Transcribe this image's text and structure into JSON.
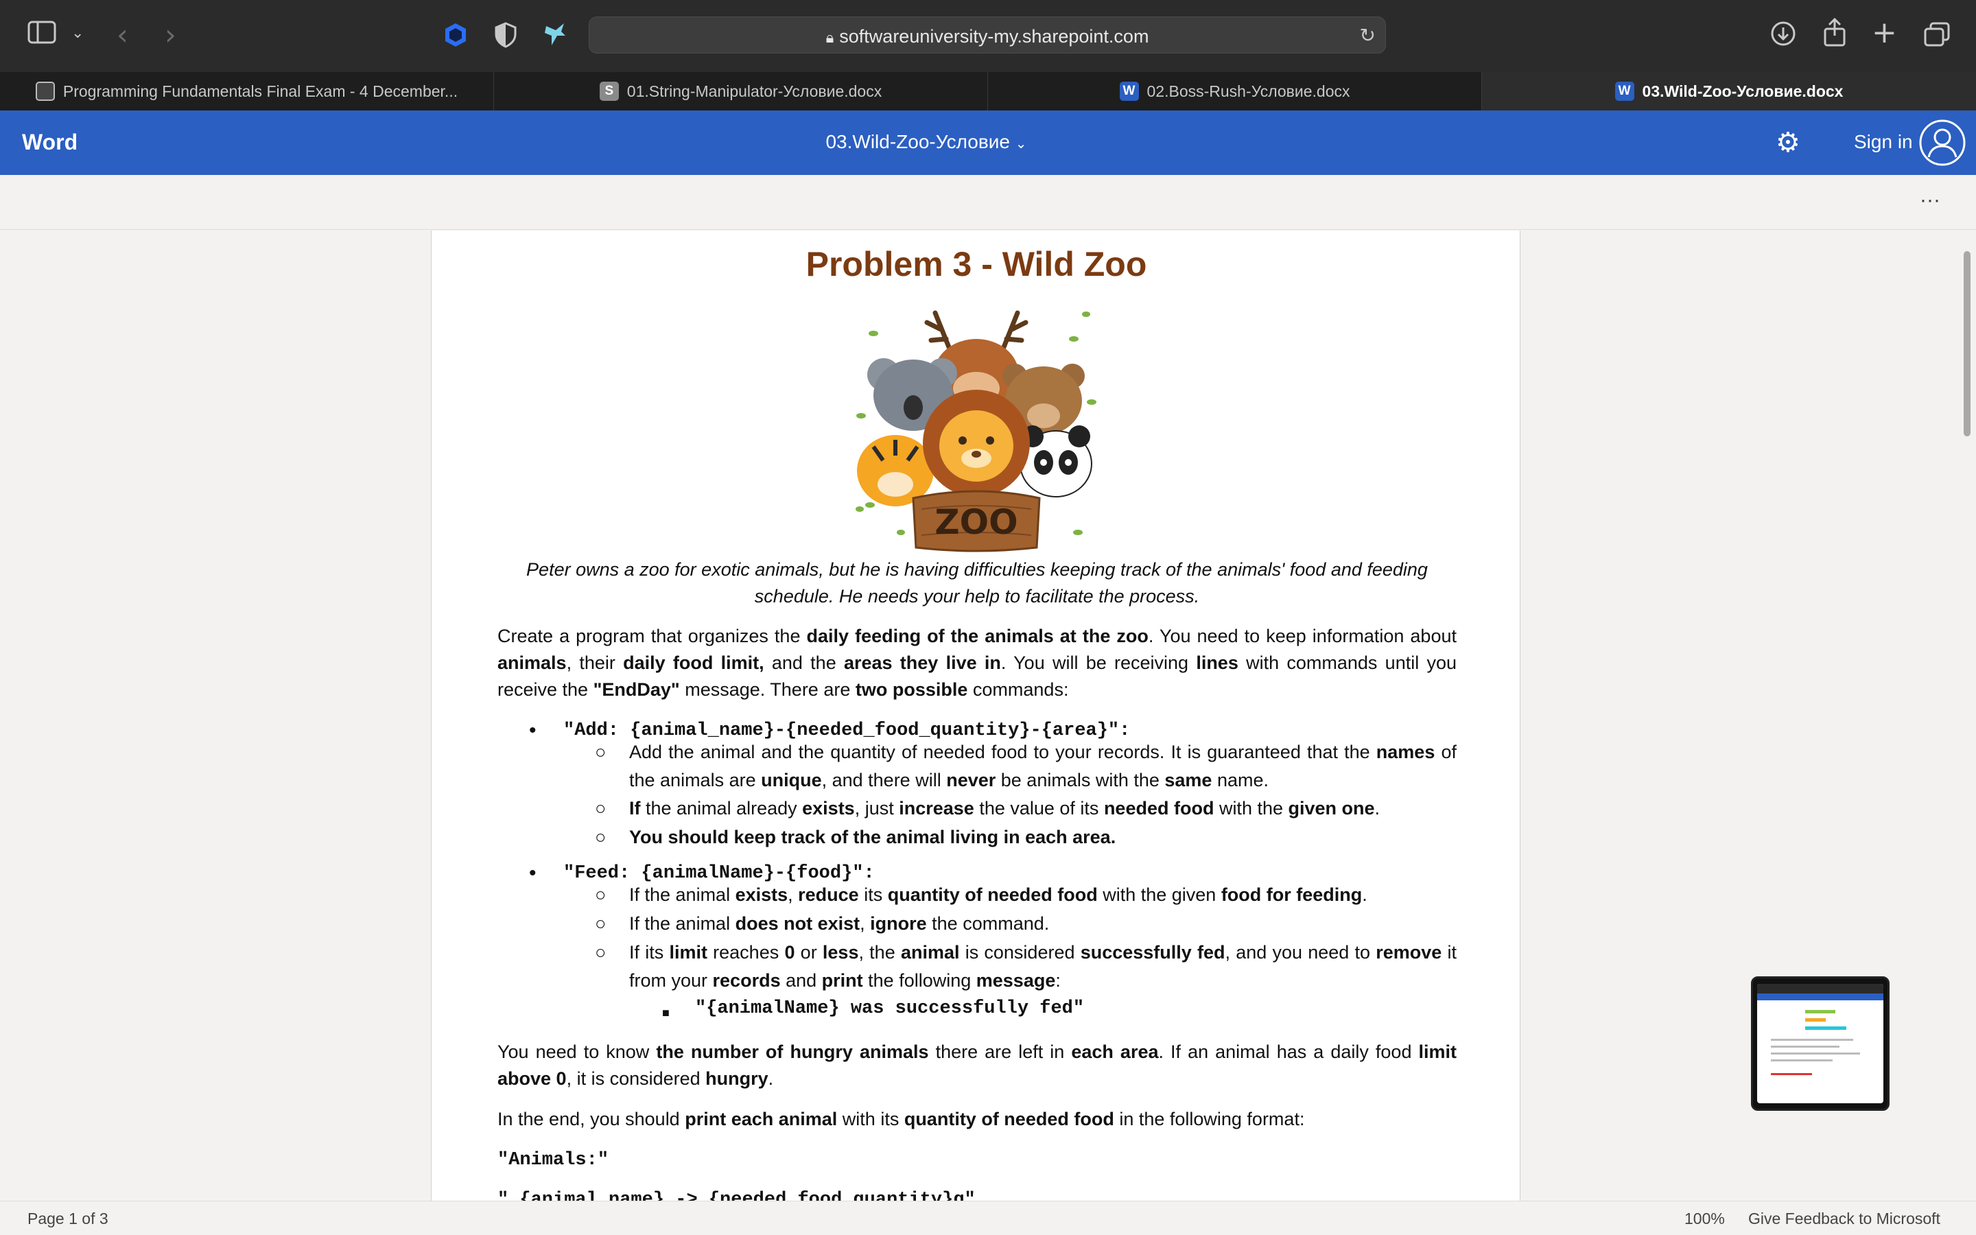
{
  "browser": {
    "url": "softwareuniversity-my.sharepoint.com",
    "tabs": [
      {
        "label": "Programming Fundamentals Final Exam - 4 December...",
        "favicon": "monitor-icon",
        "active": false
      },
      {
        "label": "01.String-Manipulator-Условие.docx",
        "favicon": "S",
        "active": false
      },
      {
        "label": "02.Boss-Rush-Условие.docx",
        "favicon": "W",
        "active": false
      },
      {
        "label": "03.Wild-Zoo-Условие.docx",
        "favicon": "W",
        "active": true
      }
    ]
  },
  "app": {
    "name": "Word",
    "doc_title": "03.Wild-Zoo-Условие",
    "sign_in": "Sign in",
    "more": "···",
    "brand_color": "#2b5fc1"
  },
  "doc": {
    "title": "Problem 3 - Wild Zoo",
    "zoo_sign": "ZOO",
    "intro_1": "Peter owns a zoo for exotic animals, but he is having difficulties keeping track of the animals' food and feeding",
    "intro_2": "schedule. He needs your help to facilitate the process.",
    "p1": {
      "a": "Create a program that organizes the ",
      "b": "daily feeding of the animals at the zoo",
      "c": ". You need to keep information about ",
      "d": "animals",
      "e": ", their ",
      "f": "daily food limit,",
      "g": " and the ",
      "h": "areas they live in",
      "i": ". You will be receiving ",
      "j": "lines",
      "k": " with commands until you receive the ",
      "l": "\"EndDay\"",
      "m": " message. There are ",
      "n": "two possible",
      "o": " commands:"
    },
    "cmd_add": "\"Add: {animal_name}-{needed_food_quantity}-{area}\":",
    "add_1": {
      "a": "Add the animal and the quantity of needed food to your records. It is guaranteed that the ",
      "b": "names",
      "c": " of the animals are ",
      "d": "unique",
      "e": ", and there will ",
      "f": "never",
      "g": " be animals with the ",
      "h": "same",
      "i": " name."
    },
    "add_2": {
      "a": "If",
      "b": " the animal already ",
      "c": "exists",
      "d": ", just ",
      "e": "increase",
      "f": " the value of its ",
      "g": "needed food",
      "h": " with the ",
      "i": "given one",
      "j": "."
    },
    "add_3": "You should keep track of the animal living in each area.",
    "cmd_feed": "\"Feed: {animalName}-{food}\":",
    "feed_1": {
      "a": "If the animal ",
      "b": "exists",
      "c": ", ",
      "d": "reduce",
      "e": " its ",
      "f": "quantity of needed food",
      "g": " with the given ",
      "h": "food for feeding",
      "i": "."
    },
    "feed_2": {
      "a": "If the animal ",
      "b": "does not exist",
      "c": ", ",
      "d": "ignore",
      "e": " the command."
    },
    "feed_3": {
      "a": "If its ",
      "b": "limit",
      "c": " reaches ",
      "d": "0",
      "e": " or ",
      "f": "less",
      "g": ", the ",
      "h": "animal",
      "i": " is considered ",
      "j": "successfully fed",
      "k": ", and you need to ",
      "l": "remove",
      "m": " it from your ",
      "n": "records",
      "o": " and ",
      "p": "print",
      "q": " the following ",
      "r": "message",
      "s": ":"
    },
    "fed_msg": "\"{animalName} was successfully fed\"",
    "p2": {
      "a": "You need to know ",
      "b": "the number of hungry animals",
      "c": " there are left in ",
      "d": "each area",
      "e": ". If an animal has a daily food ",
      "f": "limit above 0",
      "g": ", it is considered ",
      "h": "hungry",
      "i": "."
    },
    "p3": {
      "a": "In the end, you should ",
      "b": "print each animal",
      "c": " with its ",
      "d": "quantity of needed food",
      "e": " in the following format:"
    },
    "out_1": "\"Animals:\"",
    "out_2": "\" {animal_name} -> {needed_food_quantity}g\""
  },
  "status": {
    "page": "Page 1 of 3",
    "zoom": "100%",
    "feedback": "Give Feedback to Microsoft"
  }
}
